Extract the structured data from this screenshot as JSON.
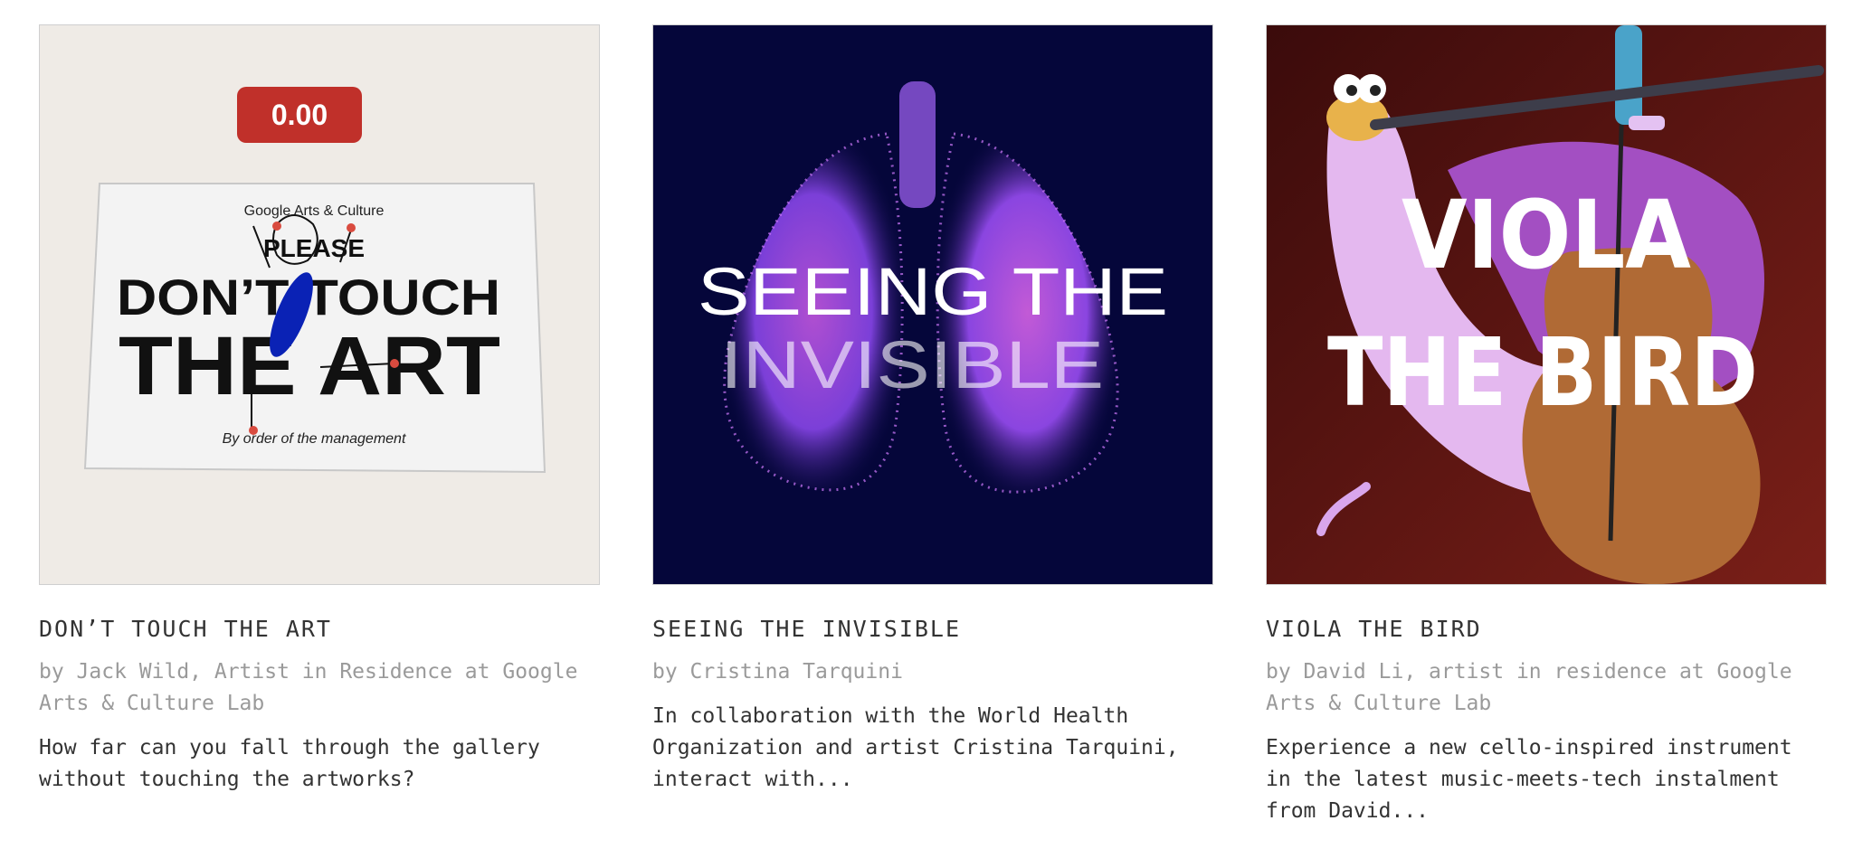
{
  "cards": [
    {
      "title": "DON’T TOUCH THE ART",
      "byline": "by Jack Wild, Artist in Residence at Google Arts & Culture Lab",
      "description": "How far can you fall through the gallery without touching the artworks?",
      "art": {
        "score": "0.00",
        "brand": "Google Arts & Culture",
        "line1": "PLEASE",
        "line2": "DON’T TOUCH",
        "line3": "THE ART",
        "footer": "By order of the management",
        "background": "#efebe6",
        "badge_color": "#c0302a"
      }
    },
    {
      "title": "SEEING THE INVISIBLE",
      "byline": "by Cristina Tarquini",
      "description": "In collaboration with the World Health Organization and artist Cristina Tarquini, interact with...",
      "art": {
        "line1": "SEEING THE",
        "line2": "INVISIBLE",
        "background": "#05063a",
        "accent": "#9b5de5"
      }
    },
    {
      "title": "VIOLA THE BIRD",
      "byline": "by David Li, artist in residence at Google Arts & Culture Lab",
      "description": "Experience a new cello-inspired instrument in the latest music-meets-tech instalment from David...",
      "art": {
        "line1": "VIOLA",
        "line2": "THE BIRD",
        "background": "#5a1512",
        "accent": "#c98bd8"
      }
    }
  ]
}
